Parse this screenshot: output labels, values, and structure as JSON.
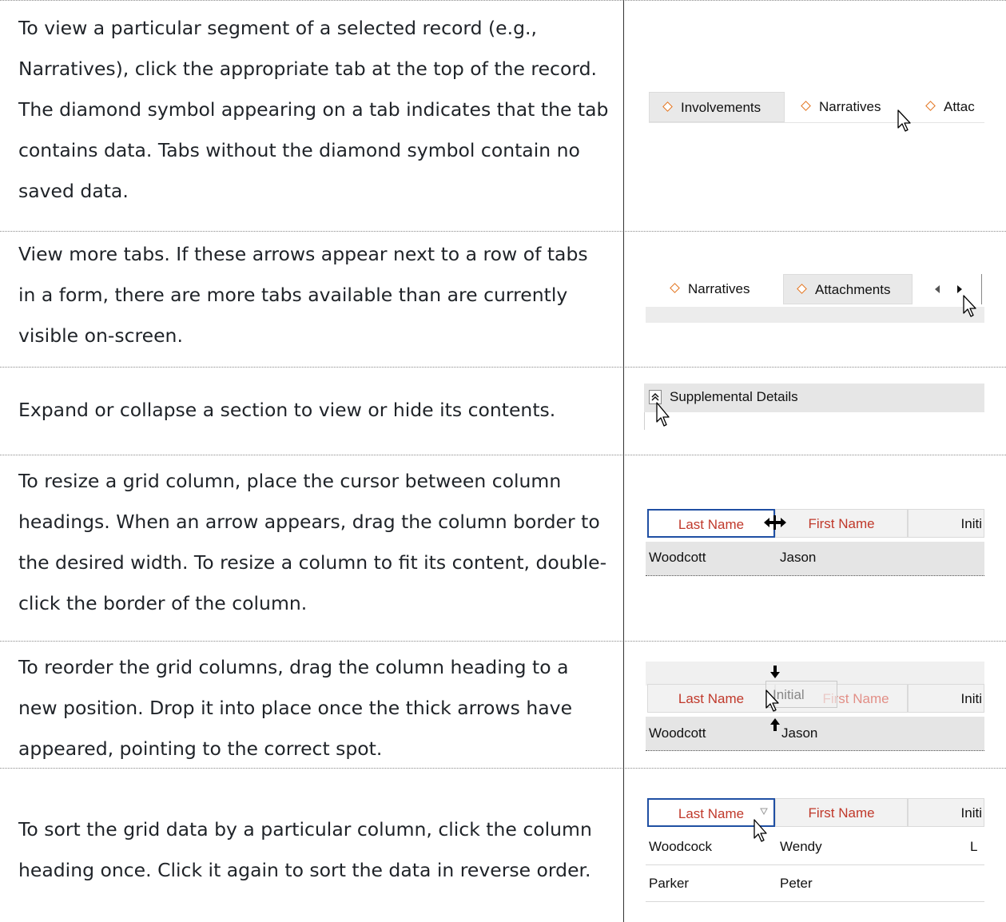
{
  "rows": [
    {
      "text": "To view a particular segment of a selected record (e.g., Narratives), click the appropriate tab at the top of the record. The diamond symbol appearing on a tab indicates that the tab contains data. Tabs without the diamond symbol contain no saved data.",
      "tabs": [
        "Involvements",
        "Narratives",
        "Attac"
      ]
    },
    {
      "text": "View more tabs. If these arrows appear next to a row of tabs in a form, there are more tabs available than are currently visible on-screen.",
      "tabs": [
        "Narratives",
        "Attachments"
      ]
    },
    {
      "text": "Expand or collapse a section to view or hide its contents.",
      "section_title": "Supplemental Details"
    },
    {
      "text": "To resize a grid column, place the cursor between column headings. When an arrow appears, drag the column border to the desired width. To resize a column to fit its content, double-click the border of the column.",
      "headers": [
        "Last Name",
        "First Name",
        "Initi"
      ],
      "row": [
        "Woodcott",
        "Jason"
      ]
    },
    {
      "text": "To reorder the grid columns, drag the column heading to a new position. Drop it into place once the thick arrows have appeared, pointing to the correct spot.",
      "headers": [
        "Last Name",
        "First Name",
        "Initi"
      ],
      "drag_label": "Initial",
      "row": [
        "Woodcott",
        "Jason"
      ]
    },
    {
      "text": "To sort the grid data by a particular column, click the column heading once. Click it again to sort the data in reverse order.",
      "headers": [
        "Last Name",
        "First Name",
        "Initi"
      ],
      "data": [
        [
          "Woodcock",
          "Wendy",
          "L"
        ],
        [
          "Parker",
          "Peter",
          ""
        ]
      ]
    }
  ],
  "colors": {
    "tab_diamond": "#e3731c",
    "header_text": "#c0392b",
    "selected_border": "#1f4fa3"
  },
  "icons": [
    "pointer-cursor-icon",
    "resize-cursor-icon",
    "scroll-left-arrow-icon",
    "scroll-right-arrow-icon",
    "collapse-chevron-icon",
    "drop-arrow-down-icon",
    "drop-arrow-up-icon",
    "sort-indicator-icon"
  ]
}
